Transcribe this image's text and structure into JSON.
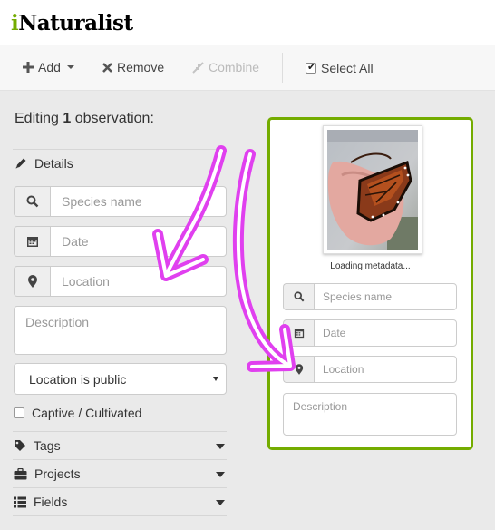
{
  "app": {
    "logo_i": "i",
    "logo_rest": "Naturalist"
  },
  "toolbar": {
    "add_label": "Add",
    "remove_label": "Remove",
    "combine_label": "Combine",
    "select_all_label": "Select All"
  },
  "editing": {
    "prefix": "Editing ",
    "count": "1",
    "suffix": " observation:"
  },
  "details": {
    "heading": "Details",
    "species_placeholder": "Species name",
    "date_placeholder": "Date",
    "location_placeholder": "Location",
    "description_placeholder": "Description",
    "geoprivacy_value": "Location is public",
    "captive_label": "Captive / Cultivated"
  },
  "sections": {
    "tags": "Tags",
    "projects": "Projects",
    "fields": "Fields"
  },
  "card": {
    "status": "Loading metadata...",
    "species_placeholder": "Species name",
    "date_placeholder": "Date",
    "location_placeholder": "Location",
    "description_placeholder": "Description"
  },
  "colors": {
    "accent": "#74ac00",
    "annotation": "#e040ef"
  },
  "icons": [
    "plus-icon",
    "times-icon",
    "compress-icon",
    "pencil-icon",
    "search-icon",
    "calendar-icon",
    "map-marker-icon",
    "tag-icon",
    "briefcase-icon",
    "list-icon",
    "annotation-arrow"
  ]
}
